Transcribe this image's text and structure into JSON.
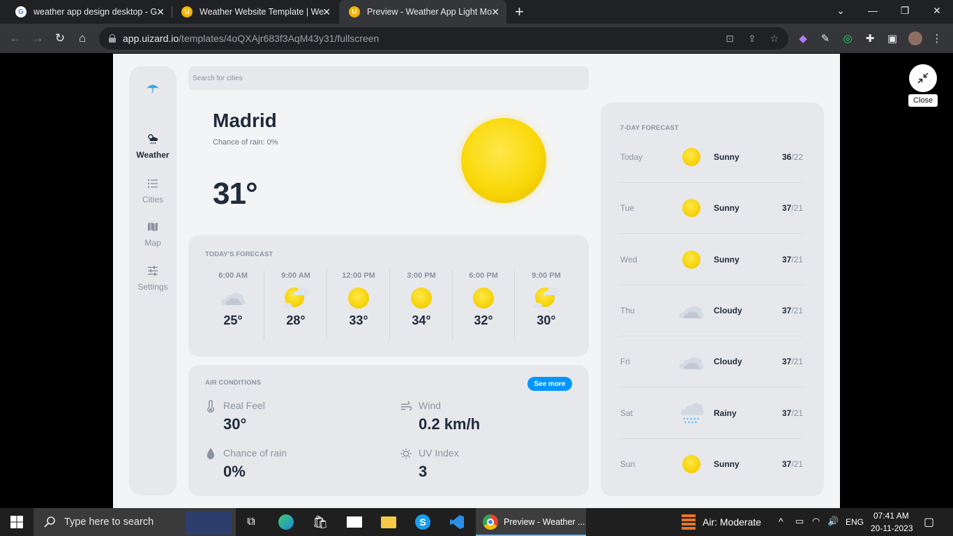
{
  "browser": {
    "tabs": [
      {
        "title": "weather app design desktop - G",
        "favicon": "google-icon"
      },
      {
        "title": "Weather Website Template | We",
        "favicon": "uizard-icon"
      },
      {
        "title": "Preview - Weather App Light Mo",
        "favicon": "uizard-icon",
        "active": true
      }
    ],
    "url_host": "app.uizard.io",
    "url_path": "/templates/4oQXAjr683f3AqM43y31/fullscreen"
  },
  "sidebar": {
    "items": [
      {
        "label": "Weather",
        "icon": "cloud-sun-rain-icon",
        "active": true
      },
      {
        "label": "Cities",
        "icon": "list-icon"
      },
      {
        "label": "Map",
        "icon": "map-icon"
      },
      {
        "label": "Settings",
        "icon": "sliders-icon"
      }
    ]
  },
  "search": {
    "placeholder": "Search for cities"
  },
  "current": {
    "city": "Madrid",
    "rain": "Chance of rain: 0%",
    "temp": "31°"
  },
  "today": {
    "title": "TODAY'S FORECAST",
    "hours": [
      {
        "time": "6:00 AM",
        "temp": "25°",
        "icon": "cloudy-icon"
      },
      {
        "time": "9:00 AM",
        "temp": "28°",
        "icon": "partly-cloudy-icon"
      },
      {
        "time": "12:00 PM",
        "temp": "33°",
        "icon": "sun-icon"
      },
      {
        "time": "3:00 PM",
        "temp": "34°",
        "icon": "sun-icon"
      },
      {
        "time": "6:00 PM",
        "temp": "32°",
        "icon": "sun-icon"
      },
      {
        "time": "9:00 PM",
        "temp": "30°",
        "icon": "partly-cloudy-icon"
      }
    ]
  },
  "air": {
    "title": "AIR CONDITIONS",
    "see_more": "See more",
    "items": [
      {
        "label": "Real Feel",
        "value": "30°",
        "icon": "thermometer-icon"
      },
      {
        "label": "Wind",
        "value": "0.2 km/h",
        "icon": "wind-icon"
      },
      {
        "label": "Chance of rain",
        "value": "0%",
        "icon": "droplet-icon"
      },
      {
        "label": "UV Index",
        "value": "3",
        "icon": "sun-outline-icon"
      }
    ]
  },
  "week": {
    "title": "7-DAY FORECAST",
    "days": [
      {
        "day": "Today",
        "cond": "Sunny",
        "high": "36",
        "low": "/22",
        "icon": "sun-icon"
      },
      {
        "day": "Tue",
        "cond": "Sunny",
        "high": "37",
        "low": "/21",
        "icon": "sun-icon"
      },
      {
        "day": "Wed",
        "cond": "Sunny",
        "high": "37",
        "low": "/21",
        "icon": "sun-icon"
      },
      {
        "day": "Thu",
        "cond": "Cloudy",
        "high": "37",
        "low": "/21",
        "icon": "cloudy-icon"
      },
      {
        "day": "Fri",
        "cond": "Cloudy",
        "high": "37",
        "low": "/21",
        "icon": "cloudy-icon"
      },
      {
        "day": "Sat",
        "cond": "Rainy",
        "high": "37",
        "low": "/21",
        "icon": "rain-icon"
      },
      {
        "day": "Sun",
        "cond": "Sunny",
        "high": "37",
        "low": "/21",
        "icon": "sun-icon"
      }
    ]
  },
  "overlay": {
    "close_label": "Close"
  },
  "taskbar": {
    "search_placeholder": "Type here to search",
    "chrome_label": "Preview - Weather ...",
    "air": "Air: Moderate",
    "lang": "ENG",
    "time": "07:41 AM",
    "date": "20-11-2023"
  },
  "colors": {
    "accent": "#0095ff",
    "page_bg": "#f3f4f6",
    "card_bg": "#e6e8ec",
    "text_dark": "#202b3b",
    "text_muted": "#8b93a1",
    "sun": "#f9d90a"
  }
}
